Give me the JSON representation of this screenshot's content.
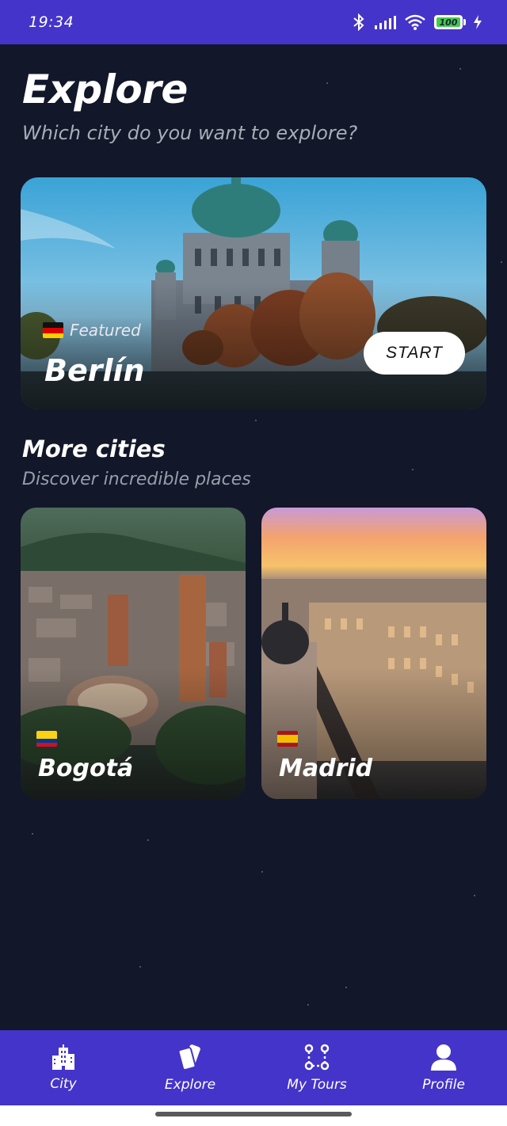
{
  "status_bar": {
    "time": "19:34",
    "battery_level": "100",
    "icons": [
      "bluetooth-icon",
      "signal-icon",
      "wifi-icon",
      "battery-icon",
      "charging-icon"
    ]
  },
  "header": {
    "title": "Explore",
    "subtitle": "Which city do you want to explore?"
  },
  "featured": {
    "badge": "Featured",
    "flag": "germany-flag-icon",
    "city": "Berlín",
    "button_label": "START"
  },
  "more_cities": {
    "title": "More cities",
    "subtitle": "Discover incredible places",
    "cities": [
      {
        "name": "Bogotá",
        "flag": "colombia-flag-icon"
      },
      {
        "name": "Madrid",
        "flag": "spain-flag-icon"
      }
    ]
  },
  "bottom_nav": {
    "items": [
      {
        "label": "City",
        "icon": "city-icon"
      },
      {
        "label": "Explore",
        "icon": "cards-icon"
      },
      {
        "label": "My Tours",
        "icon": "route-icon"
      },
      {
        "label": "Profile",
        "icon": "person-icon"
      }
    ]
  },
  "colors": {
    "background": "#121729",
    "accent": "#4434c9",
    "muted_text": "#a9acb8"
  }
}
